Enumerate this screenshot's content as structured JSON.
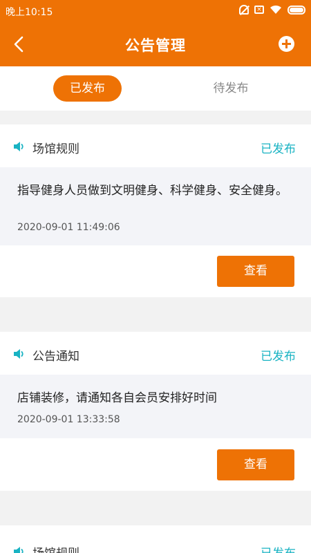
{
  "status_bar": {
    "time": "晚上10:15"
  },
  "header": {
    "title": "公告管理"
  },
  "tabs": [
    {
      "label": "已发布",
      "active": true
    },
    {
      "label": "待发布",
      "active": false
    }
  ],
  "notices": [
    {
      "title": "场馆规则",
      "status": "已发布",
      "content": "指导健身人员做到文明健身、科学健身、安全健身。",
      "date": "2020-09-01 11:49:06",
      "button": "查看"
    },
    {
      "title": "公告通知",
      "status": "已发布",
      "content": "店铺装修，请通知各自会员安排好时间",
      "date": "2020-09-01 13:33:58",
      "button": "查看"
    },
    {
      "title": "场馆规则",
      "status": "已发布"
    }
  ],
  "colors": {
    "primary": "#ee7205",
    "accent": "#19b3c3",
    "body_bg": "#f3f4f8"
  }
}
